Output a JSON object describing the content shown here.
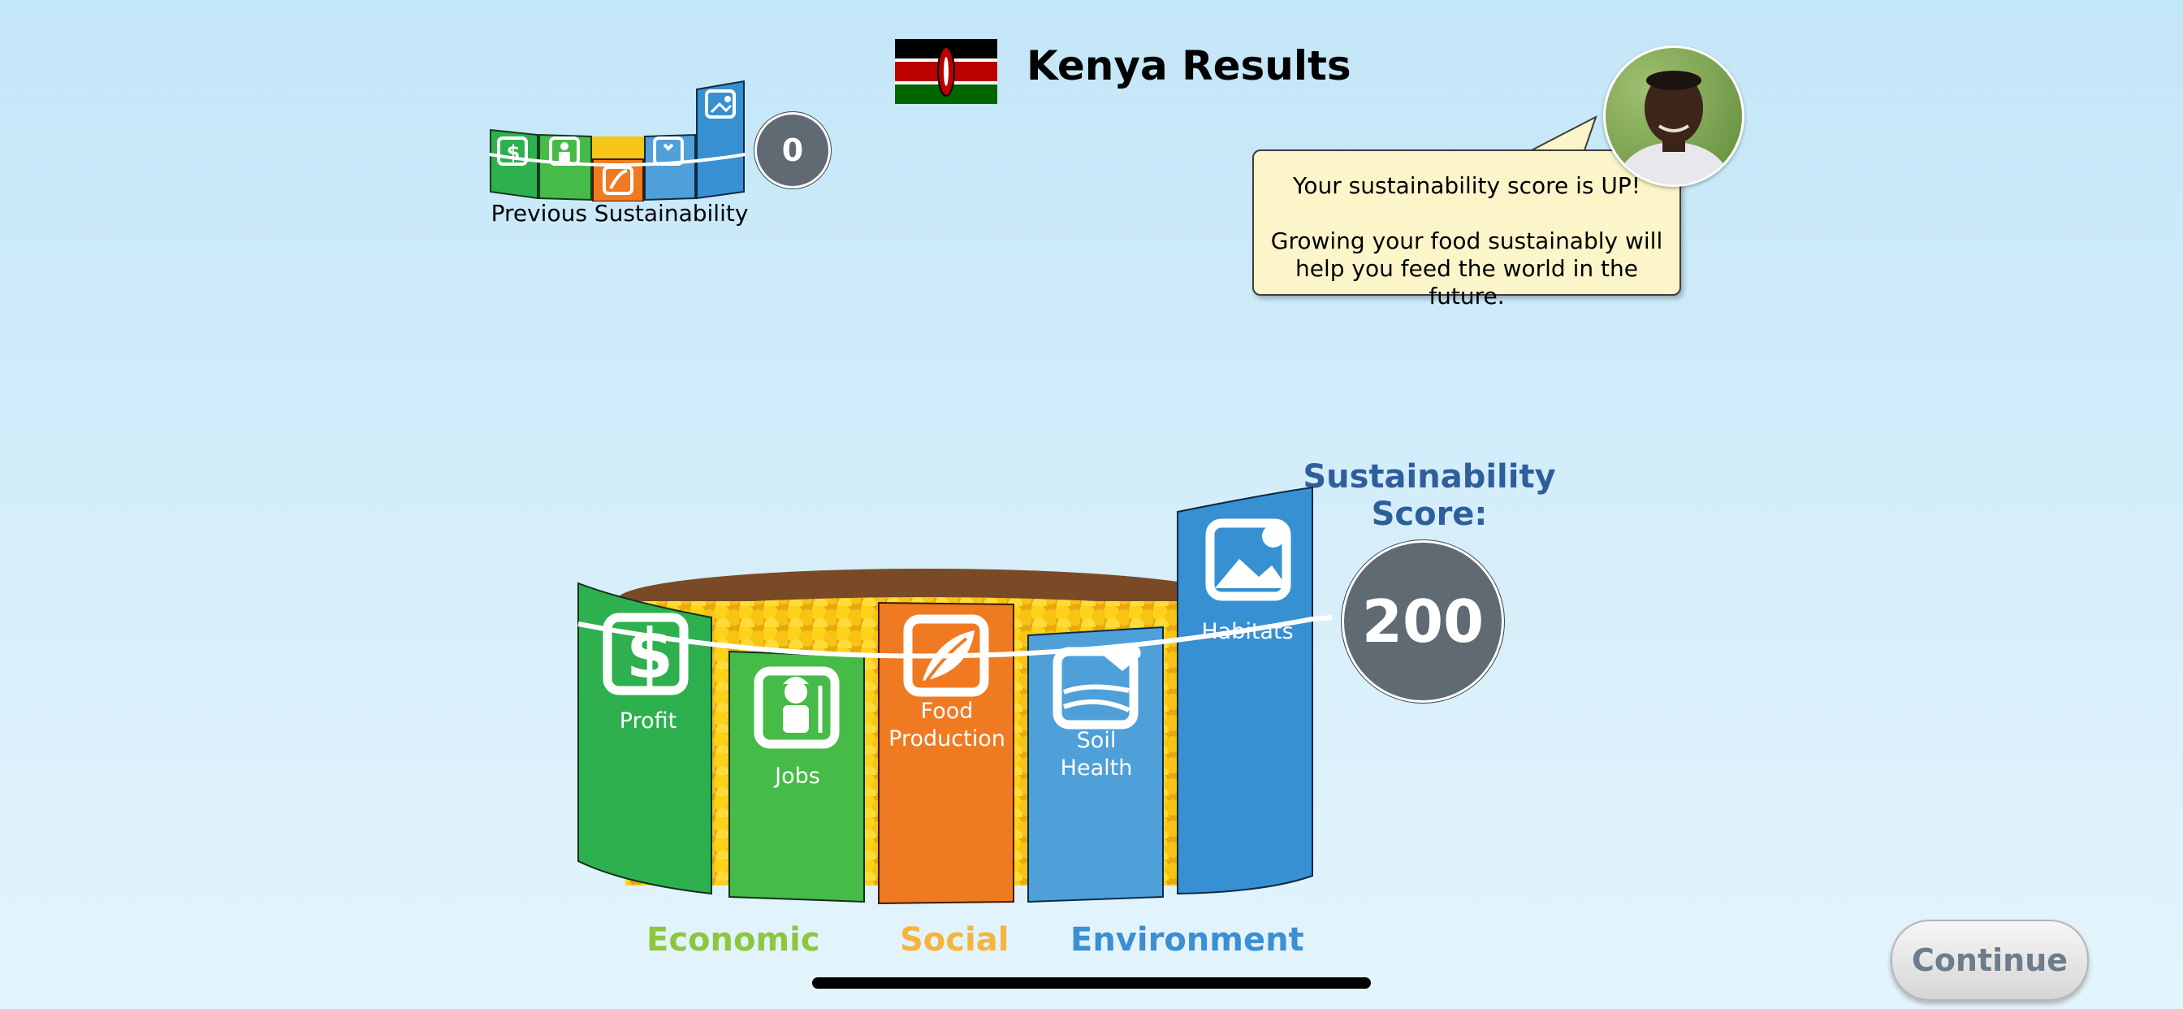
{
  "header": {
    "title": "Kenya Results",
    "flag": "kenya-flag-icon"
  },
  "previous": {
    "label": "Previous Sustainability",
    "score": "0"
  },
  "bubble": {
    "line1": "Your sustainability score is UP!",
    "line2": "Growing your food sustainably will",
    "line3": "help you feed the world in the future."
  },
  "score": {
    "title_line1": "Sustainability",
    "title_line2": "Score:",
    "value": "200"
  },
  "bars": {
    "profit": "Profit",
    "jobs": "Jobs",
    "food_line1": "Food",
    "food_line2": "Production",
    "soil_line1": "Soil",
    "soil_line2": "Health",
    "habitats": "Habitats"
  },
  "categories": {
    "economic": "Economic",
    "social": "Social",
    "environment": "Environment"
  },
  "continue_label": "Continue",
  "colors": {
    "profit": "#2eb04f",
    "jobs": "#46bb47",
    "food": "#f07a22",
    "soil": "#4f9fd9",
    "habitats": "#3790d2",
    "score_title": "#2f5f9a",
    "corn": "#f5c518"
  }
}
